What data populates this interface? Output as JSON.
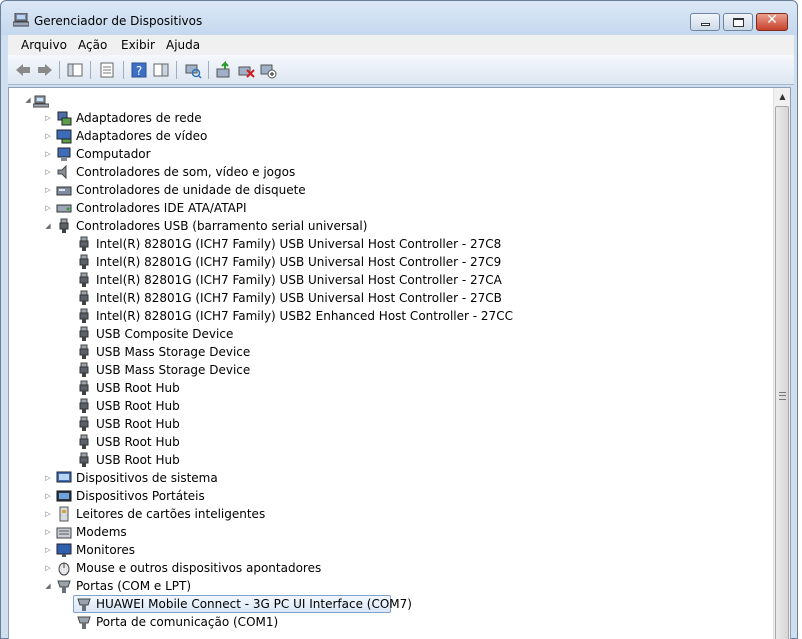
{
  "window": {
    "title": "Gerenciador de Dispositivos"
  },
  "menu": [
    "Arquivo",
    "Ação",
    "Exibir",
    "Ajuda"
  ],
  "toolbar": [
    "back-icon",
    "forward-icon",
    "show-hide-console-tree-icon",
    "properties-icon",
    "help-icon",
    "action-pane-icon",
    "scan-hardware-icon",
    "update-driver-icon",
    "uninstall-icon",
    "disable-icon"
  ],
  "tree": [
    {
      "label": "",
      "level": 0,
      "expanded": true,
      "icon": "computer-root-icon"
    },
    {
      "label": "Adaptadores de rede",
      "level": 1,
      "expanded": false,
      "icon": "network-adapter-icon"
    },
    {
      "label": "Adaptadores de vídeo",
      "level": 1,
      "expanded": false,
      "icon": "display-adapter-icon"
    },
    {
      "label": "Computador",
      "level": 1,
      "expanded": false,
      "icon": "computer-icon"
    },
    {
      "label": "Controladores de som, vídeo e jogos",
      "level": 1,
      "expanded": false,
      "icon": "sound-icon"
    },
    {
      "label": "Controladores de unidade de disquete",
      "level": 1,
      "expanded": false,
      "icon": "floppy-controller-icon"
    },
    {
      "label": "Controladores IDE ATA/ATAPI",
      "level": 1,
      "expanded": false,
      "icon": "ide-controller-icon"
    },
    {
      "label": "Controladores USB (barramento serial universal)",
      "level": 1,
      "expanded": true,
      "icon": "usb-icon"
    },
    {
      "label": "Intel(R) 82801G (ICH7 Family) USB Universal Host Controller - 27C8",
      "level": 2,
      "icon": "usb-icon"
    },
    {
      "label": "Intel(R) 82801G (ICH7 Family) USB Universal Host Controller - 27C9",
      "level": 2,
      "icon": "usb-icon"
    },
    {
      "label": "Intel(R) 82801G (ICH7 Family) USB Universal Host Controller - 27CA",
      "level": 2,
      "icon": "usb-icon"
    },
    {
      "label": "Intel(R) 82801G (ICH7 Family) USB Universal Host Controller - 27CB",
      "level": 2,
      "icon": "usb-icon"
    },
    {
      "label": "Intel(R) 82801G (ICH7 Family) USB2 Enhanced Host Controller - 27CC",
      "level": 2,
      "icon": "usb-icon"
    },
    {
      "label": "USB Composite Device",
      "level": 2,
      "icon": "usb-icon"
    },
    {
      "label": "USB Mass Storage Device",
      "level": 2,
      "icon": "usb-icon"
    },
    {
      "label": "USB Mass Storage Device",
      "level": 2,
      "icon": "usb-icon"
    },
    {
      "label": "USB Root Hub",
      "level": 2,
      "icon": "usb-icon"
    },
    {
      "label": "USB Root Hub",
      "level": 2,
      "icon": "usb-icon"
    },
    {
      "label": "USB Root Hub",
      "level": 2,
      "icon": "usb-icon"
    },
    {
      "label": "USB Root Hub",
      "level": 2,
      "icon": "usb-icon"
    },
    {
      "label": "USB Root Hub",
      "level": 2,
      "icon": "usb-icon"
    },
    {
      "label": "Dispositivos de sistema",
      "level": 1,
      "expanded": false,
      "icon": "system-devices-icon"
    },
    {
      "label": "Dispositivos Portáteis",
      "level": 1,
      "expanded": false,
      "icon": "portable-devices-icon"
    },
    {
      "label": "Leitores de cartões inteligentes",
      "level": 1,
      "expanded": false,
      "icon": "smart-card-reader-icon"
    },
    {
      "label": "Modems",
      "level": 1,
      "expanded": false,
      "icon": "modem-icon"
    },
    {
      "label": "Monitores",
      "level": 1,
      "expanded": false,
      "icon": "monitor-icon"
    },
    {
      "label": "Mouse e outros dispositivos apontadores",
      "level": 1,
      "expanded": false,
      "icon": "mouse-icon"
    },
    {
      "label": "Portas (COM e LPT)",
      "level": 1,
      "expanded": true,
      "icon": "port-icon"
    },
    {
      "label": "HUAWEI Mobile Connect - 3G PC UI Interface (COM7)",
      "level": 2,
      "icon": "port-icon",
      "selected": true
    },
    {
      "label": "Porta de comunicação (COM1)",
      "level": 2,
      "icon": "port-icon"
    }
  ]
}
